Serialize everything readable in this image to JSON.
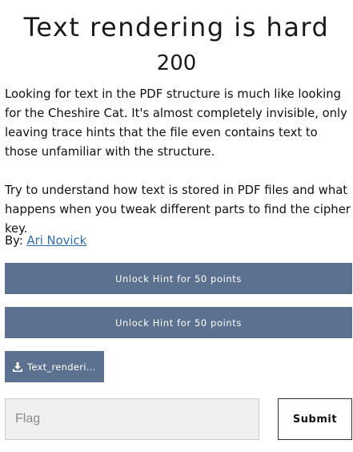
{
  "challenge": {
    "title": "Text rendering is hard",
    "points": "200",
    "description_paragraphs": [
      "Looking for text in the PDF structure is much like looking for the Cheshire Cat. It's almost completely invisible, only leaving trace hints that the file even contains text to those unfamiliar with the structure.",
      "Try to understand how text is stored in PDF files and what happens when you tweak different parts to find the cipher key."
    ],
    "author_prefix": "By: ",
    "author_name": "Ari Novick"
  },
  "hints": [
    {
      "label": "Unlock Hint for 50 points"
    },
    {
      "label": "Unlock Hint for 50 points"
    }
  ],
  "file": {
    "label": "Text_renderi...",
    "icon": "download-icon"
  },
  "flag_form": {
    "input_placeholder": "Flag",
    "input_value": "",
    "submit_label": "Submit"
  },
  "colors": {
    "button_bg": "#5b718f",
    "link": "#2b6fad",
    "input_bg": "#f0f0f0"
  }
}
